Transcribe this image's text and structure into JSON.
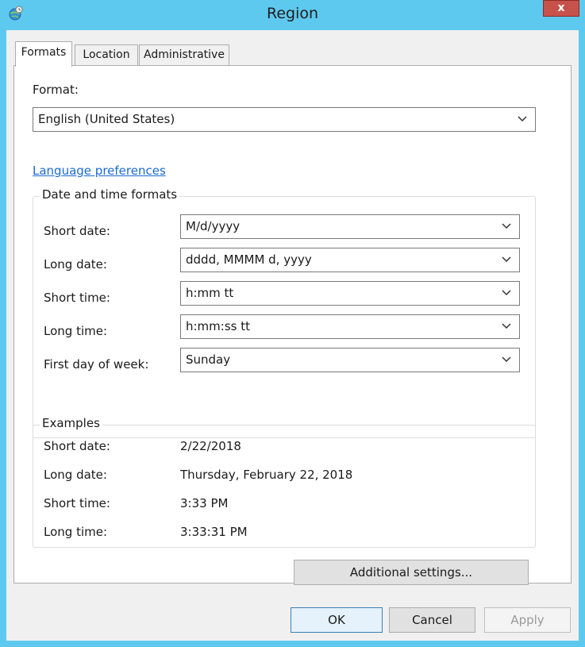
{
  "window": {
    "title": "Region",
    "close_label": "x"
  },
  "tabs": [
    {
      "label": "Formats",
      "active": true
    },
    {
      "label": "Location",
      "active": false
    },
    {
      "label": "Administrative",
      "active": false
    }
  ],
  "formats": {
    "format_label": "Format:",
    "format_value": "English (United States)",
    "language_link": "Language preferences",
    "date_time_group_title": "Date and time formats",
    "fields": [
      {
        "label": "Short date:",
        "value": "M/d/yyyy"
      },
      {
        "label": "Long date:",
        "value": "dddd, MMMM d, yyyy"
      },
      {
        "label": "Short time:",
        "value": "h:mm tt"
      },
      {
        "label": "Long time:",
        "value": "h:mm:ss tt"
      },
      {
        "label": "First day of week:",
        "value": "Sunday"
      }
    ],
    "examples_group_title": "Examples",
    "examples": [
      {
        "label": "Short date:",
        "value": "2/22/2018"
      },
      {
        "label": "Long date:",
        "value": "Thursday, February 22, 2018"
      },
      {
        "label": "Short time:",
        "value": "3:33 PM"
      },
      {
        "label": "Long time:",
        "value": "3:33:31 PM"
      }
    ],
    "additional_settings_label": "Additional settings..."
  },
  "buttons": {
    "ok": "OK",
    "cancel": "Cancel",
    "apply": "Apply"
  },
  "colors": {
    "title_bar": "#5ec9ee",
    "close_button": "#c7524b",
    "link": "#1c6bd0"
  }
}
